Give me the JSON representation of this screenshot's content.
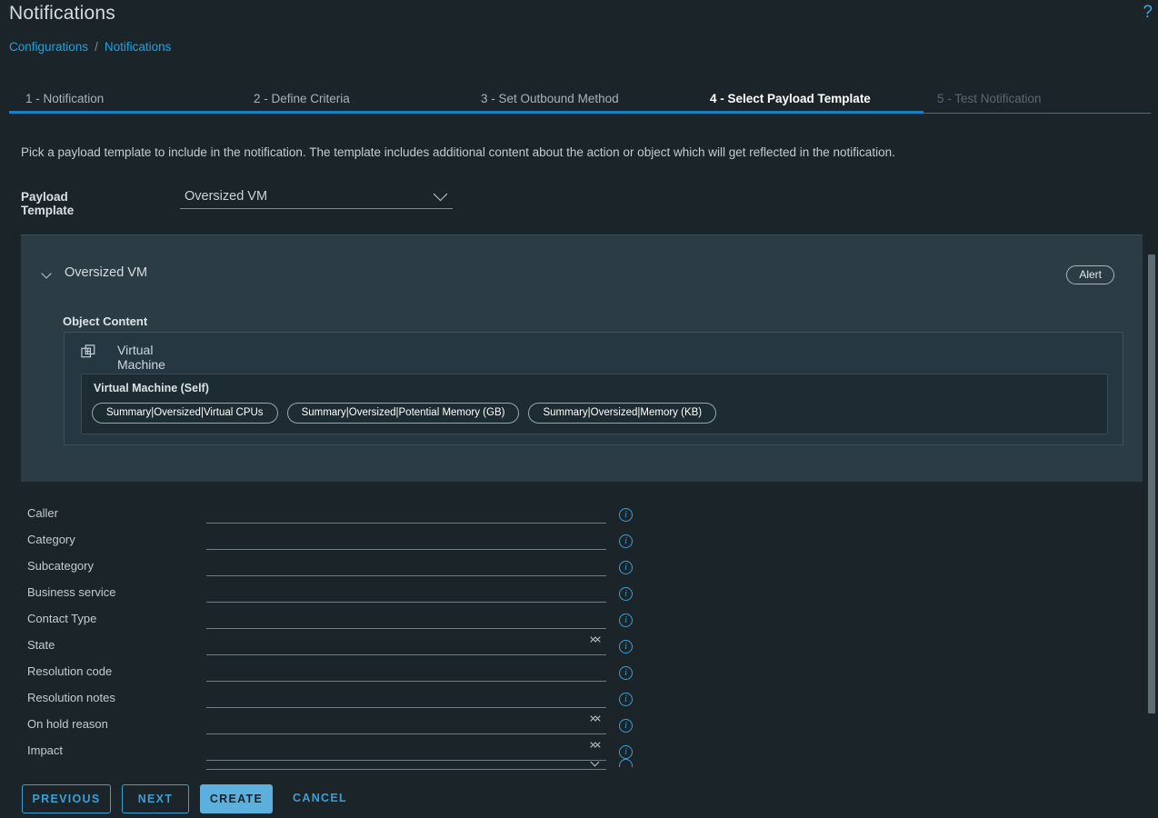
{
  "header": {
    "title": "Notifications",
    "help_icon": "question-mark-icon"
  },
  "breadcrumb": {
    "root": "Configurations",
    "separator": "/",
    "current": "Notifications"
  },
  "tabs": [
    {
      "label": "1 - Notification",
      "state": "completed"
    },
    {
      "label": "2 - Define Criteria",
      "state": "completed"
    },
    {
      "label": "3 - Set Outbound Method",
      "state": "completed"
    },
    {
      "label": "4 - Select Payload Template",
      "state": "active"
    },
    {
      "label": "5 - Test Notification",
      "state": "disabled"
    }
  ],
  "main": {
    "description": "Pick a payload template to include in the notification. The template includes additional content about the action or object which will get reflected in the notification.",
    "payload_template": {
      "label": "Payload Template",
      "value": "Oversized VM",
      "chevron": "chevron-down-icon"
    },
    "card": {
      "title": "Oversized VM",
      "badge": "Alert",
      "object_content_label": "Object Content",
      "object": {
        "icon": "virtual-machine-icon",
        "title": "Virtual Machine",
        "self_group_title": "Virtual Machine (Self)",
        "metrics": [
          "Summary|Oversized|Virtual CPUs",
          "Summary|Oversized|Potential Memory (GB)",
          "Summary|Oversized|Memory (KB)"
        ]
      }
    }
  },
  "form": {
    "fields": [
      {
        "label": "Caller",
        "value": "",
        "type": "text",
        "info": "info-icon"
      },
      {
        "label": "Category",
        "value": "",
        "type": "text",
        "info": "info-icon"
      },
      {
        "label": "Subcategory",
        "value": "",
        "type": "text",
        "info": "info-icon"
      },
      {
        "label": "Business service",
        "value": "",
        "type": "text",
        "info": "info-icon"
      },
      {
        "label": "Contact Type",
        "value": "",
        "type": "text",
        "info": "info-icon"
      },
      {
        "label": "State",
        "value": "",
        "type": "stepper",
        "info": "info-icon"
      },
      {
        "label": "Resolution code",
        "value": "",
        "type": "text",
        "info": "info-icon"
      },
      {
        "label": "Resolution notes",
        "value": "",
        "type": "text",
        "info": "info-icon"
      },
      {
        "label": "On hold reason",
        "value": "",
        "type": "stepper",
        "info": "info-icon"
      },
      {
        "label": "Impact",
        "value": "",
        "type": "stepper",
        "info": "info-icon"
      }
    ]
  },
  "footer": {
    "previous": "PREVIOUS",
    "next": "NEXT",
    "create": "CREATE",
    "cancel": "CANCEL"
  },
  "colors": {
    "page_bg": "#1b2429",
    "card_bg": "#2b3c44",
    "inner_card_bg": "#253841",
    "self_card_bg": "#1d2b32",
    "accent": "#3d9fd4",
    "accent_filled": "#5bb0dd",
    "tab_active_underline": "#1a7fc1",
    "link": "#1ea3e0"
  }
}
